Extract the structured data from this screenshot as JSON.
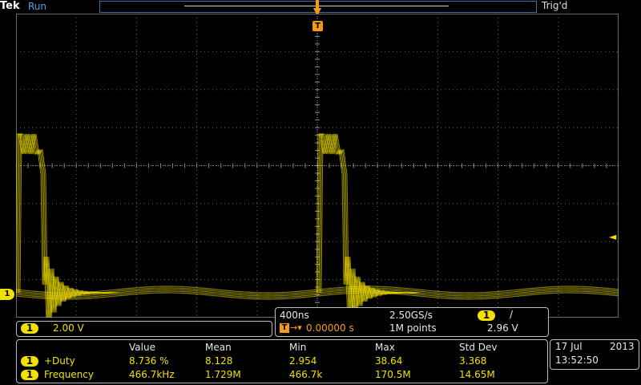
{
  "top": {
    "brand": "Tek",
    "run_state": "Run",
    "trig_status": "Trig'd"
  },
  "trigger": {
    "position_label": "T",
    "level_arrow": "◄"
  },
  "channel": {
    "marker": "1",
    "badge": "1",
    "scale": "2.00 V"
  },
  "timebase": {
    "horizontal_scale": "400ns",
    "sample_rate": "2.50GS/s",
    "trigger_badge": "1",
    "trigger_slope": "/",
    "trigger_marker": "T",
    "delay_arrow": "→▾",
    "delay": "0.00000 s",
    "record_length": "1M points",
    "trigger_level": "2.96 V"
  },
  "measurements": {
    "headers": [
      "Value",
      "Mean",
      "Min",
      "Max",
      "Std Dev"
    ],
    "rows": [
      {
        "badge": "1",
        "name": "+Duty",
        "values": [
          "8.736 %",
          "8.128",
          "2.954",
          "38.64",
          "3.368"
        ]
      },
      {
        "badge": "1",
        "name": "Frequency",
        "values": [
          "466.7kHz",
          "1.729M",
          "466.7k",
          "170.5M",
          "14.65M"
        ]
      }
    ]
  },
  "datetime": {
    "date": "17 Jul",
    "year": "2013",
    "time": "13:52:50"
  },
  "colors": {
    "trace": "#f1e000",
    "trigger": "#f39c12",
    "grid": "#6a6a6a",
    "run": "#5aa0e6"
  }
}
